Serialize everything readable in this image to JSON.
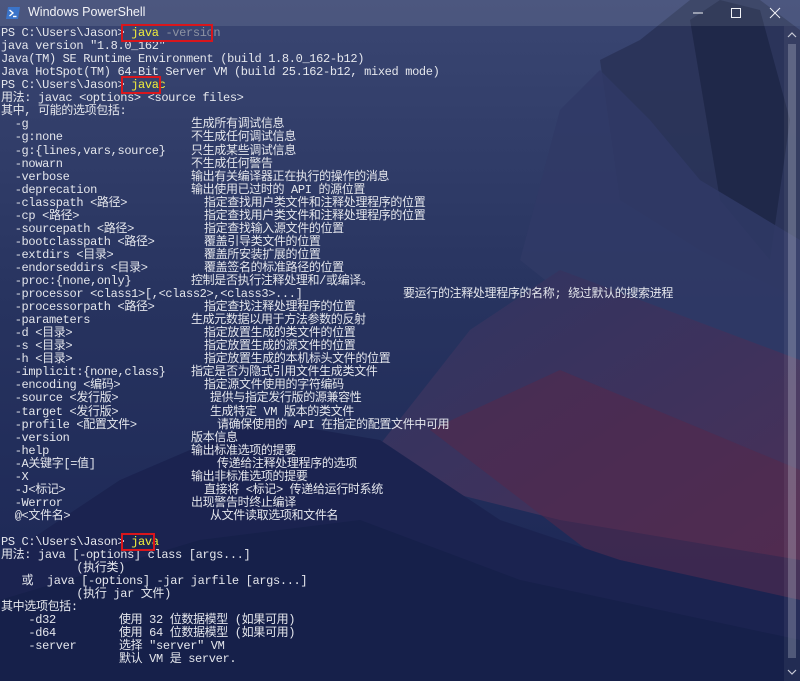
{
  "window": {
    "title": "Windows PowerShell",
    "colors": {
      "text": "#e4e6ec",
      "command": "#f1ee3c",
      "argument": "#8d93a3",
      "highlight_box": "#d8161c"
    },
    "icons": {
      "app": "powershell-icon",
      "minimize": "minimize-icon",
      "maximize": "maximize-icon",
      "close": "close-icon"
    }
  },
  "terminal": {
    "lines": [
      {
        "prompt": "PS C:\\Users\\Jason> ",
        "command": "java",
        "args": " -version"
      },
      {
        "text": "java version \"1.8.0_162\""
      },
      {
        "text": "Java(TM) SE Runtime Environment (build 1.8.0_162-b12)"
      },
      {
        "text": "Java HotSpot(TM) 64-Bit Server VM (build 25.162-b12, mixed mode)"
      },
      {
        "prompt": "PS C:\\Users\\Jason> ",
        "command": "javac"
      },
      {
        "text": "用法: javac <options> <source files>"
      },
      {
        "text": "其中, 可能的选项包括:"
      },
      {
        "opt": "  -g",
        "desc": "生成所有调试信息"
      },
      {
        "opt": "  -g:none",
        "desc": "不生成任何调试信息"
      },
      {
        "opt": "  -g:{lines,vars,source}",
        "desc": "只生成某些调试信息"
      },
      {
        "opt": "  -nowarn",
        "desc": "不生成任何警告"
      },
      {
        "opt": "  -verbose",
        "desc": "输出有关编译器正在执行的操作的消息"
      },
      {
        "opt": "  -deprecation",
        "desc": "输出使用已过时的 API 的源位置"
      },
      {
        "opt": "  -classpath <路径>",
        "desc": "指定查找用户类文件和注释处理程序的位置"
      },
      {
        "opt": "  -cp <路径>",
        "desc": "指定查找用户类文件和注释处理程序的位置"
      },
      {
        "opt": "  -sourcepath <路径>",
        "desc": "指定查找输入源文件的位置"
      },
      {
        "opt": "  -bootclasspath <路径>",
        "desc": "覆盖引导类文件的位置"
      },
      {
        "opt": "  -extdirs <目录>",
        "desc": "覆盖所安装扩展的位置"
      },
      {
        "opt": "  -endorseddirs <目录>",
        "desc": "覆盖签名的标准路径的位置"
      },
      {
        "opt": "  -proc:{none,only}",
        "desc": "控制是否执行注释处理和/或编译。"
      },
      {
        "opt": "  -processor <class1>[,<class2>,<class3>...]",
        "desc": "要运行的注释处理程序的名称; 绕过默认的搜索进程"
      },
      {
        "opt": "  -processorpath <路径>",
        "desc": "指定查找注释处理程序的位置"
      },
      {
        "opt": "  -parameters",
        "desc": "生成元数据以用于方法参数的反射"
      },
      {
        "opt": "  -d <目录>",
        "desc": "指定放置生成的类文件的位置"
      },
      {
        "opt": "  -s <目录>",
        "desc": "指定放置生成的源文件的位置"
      },
      {
        "opt": "  -h <目录>",
        "desc": "指定放置生成的本机标头文件的位置"
      },
      {
        "opt": "  -implicit:{none,class}",
        "desc": "指定是否为隐式引用文件生成类文件"
      },
      {
        "opt": "  -encoding <编码>",
        "desc": "指定源文件使用的字符编码"
      },
      {
        "opt": "  -source <发行版>",
        "desc": "提供与指定发行版的源兼容性"
      },
      {
        "opt": "  -target <发行版>",
        "desc": "生成特定 VM 版本的类文件"
      },
      {
        "opt": "  -profile <配置文件>",
        "desc": "请确保使用的 API 在指定的配置文件中可用"
      },
      {
        "opt": "  -version",
        "desc": "版本信息"
      },
      {
        "opt": "  -help",
        "desc": "输出标准选项的提要"
      },
      {
        "opt": "  -A关键字[=值]",
        "desc": "传递给注释处理程序的选项"
      },
      {
        "opt": "  -X",
        "desc": "输出非标准选项的提要"
      },
      {
        "opt": "  -J<标记>",
        "desc": "直接将 <标记> 传递给运行时系统"
      },
      {
        "opt": "  -Werror",
        "desc": "出现警告时终止编译"
      },
      {
        "opt": "  @<文件名>",
        "desc": "从文件读取选项和文件名"
      },
      {
        "text": ""
      },
      {
        "prompt": "PS C:\\Users\\Jason> ",
        "command": "java"
      },
      {
        "text": "用法: java [-options] class [args...]"
      },
      {
        "text": "           (执行类)"
      },
      {
        "text": "   或  java [-options] -jar jarfile [args...]"
      },
      {
        "text": "           (执行 jar 文件)"
      },
      {
        "text": "其中选项包括:"
      },
      {
        "opt": "    -d32",
        "desc": "使用 32 位数据模型 (如果可用)"
      },
      {
        "opt": "    -d64",
        "desc": "使用 64 位数据模型 (如果可用)"
      },
      {
        "opt": "    -server",
        "desc": "选择 \"server\" VM"
      },
      {
        "opt": "",
        "desc": "默认 VM 是 server."
      }
    ]
  }
}
